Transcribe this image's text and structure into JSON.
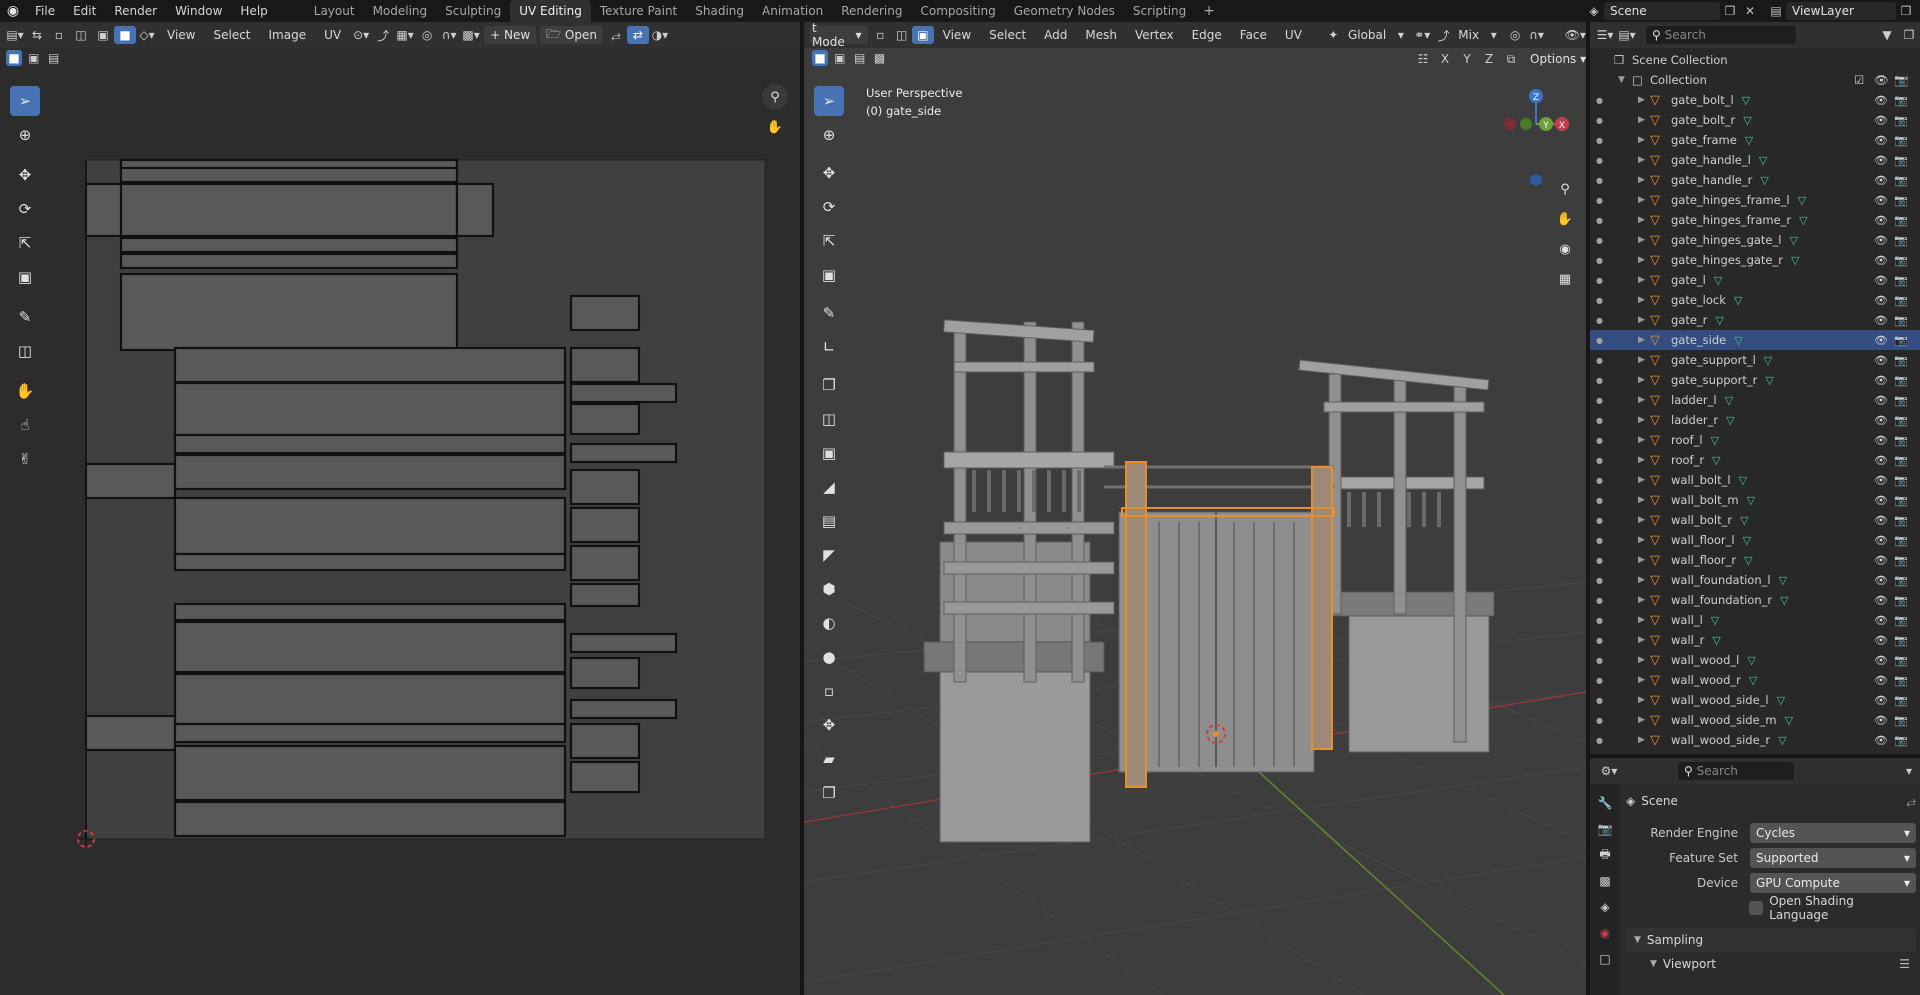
{
  "topbar": {
    "menus": [
      "File",
      "Edit",
      "Render",
      "Window",
      "Help"
    ],
    "workspaces": [
      "Layout",
      "Modeling",
      "Sculpting",
      "UV Editing",
      "Texture Paint",
      "Shading",
      "Animation",
      "Rendering",
      "Compositing",
      "Geometry Nodes",
      "Scripting"
    ],
    "active_workspace": "UV Editing",
    "scene": "Scene",
    "view_layer": "ViewLayer"
  },
  "uv_editor": {
    "menus": [
      "View",
      "Select",
      "Image",
      "UV"
    ],
    "new_label": "New",
    "open_label": "Open"
  },
  "viewport": {
    "mode_label": "t Mode",
    "menus": [
      "View",
      "Select",
      "Add",
      "Mesh",
      "Vertex",
      "Edge",
      "Face",
      "UV"
    ],
    "orientation": "Global",
    "mix_label": "Mix",
    "overlay_title": "User Perspective",
    "overlay_object": "(0) gate_side",
    "options_label": "Options",
    "axis_x": "X",
    "axis_y": "Y",
    "axis_z": "Z"
  },
  "outliner": {
    "search_placeholder": "Search",
    "scene_collection": "Scene Collection",
    "collection": "Collection",
    "selected": "gate_side",
    "items": [
      "gate_bolt_l",
      "gate_bolt_r",
      "gate_frame",
      "gate_handle_l",
      "gate_handle_r",
      "gate_hinges_frame_l",
      "gate_hinges_frame_r",
      "gate_hinges_gate_l",
      "gate_hinges_gate_r",
      "gate_l",
      "gate_lock",
      "gate_r",
      "gate_side",
      "gate_support_l",
      "gate_support_r",
      "ladder_l",
      "ladder_r",
      "roof_l",
      "roof_r",
      "wall_bolt_l",
      "wall_bolt_m",
      "wall_bolt_r",
      "wall_floor_l",
      "wall_floor_r",
      "wall_foundation_l",
      "wall_foundation_r",
      "wall_l",
      "wall_r",
      "wall_wood_l",
      "wall_wood_r",
      "wall_wood_side_l",
      "wall_wood_side_m",
      "wall_wood_side_r"
    ]
  },
  "properties": {
    "search_placeholder": "Search",
    "context": "Scene",
    "render_engine_label": "Render Engine",
    "render_engine": "Cycles",
    "feature_set_label": "Feature Set",
    "feature_set": "Supported",
    "device_label": "Device",
    "device": "GPU Compute",
    "osl_label": "Open Shading Language",
    "osl_checked": false,
    "sampling_label": "Sampling",
    "viewport_label": "Viewport"
  },
  "colors": {
    "accent": "#4772b3",
    "selection_orange": "#e88f2c",
    "mesh_icon": "#4fc48f",
    "axis_x": "#c33e4f",
    "axis_y": "#6ba33a",
    "axis_z": "#3b74c8"
  }
}
